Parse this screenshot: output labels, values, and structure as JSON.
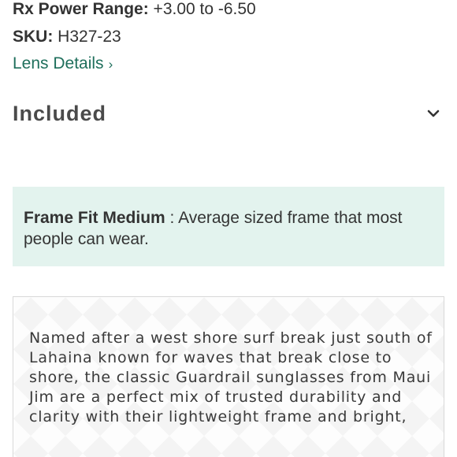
{
  "specs": {
    "rx_label": "Rx Power Range:",
    "rx_value": " +3.00 to -6.50",
    "sku_label": "SKU:",
    "sku_value": " H327-23"
  },
  "lens_link": {
    "label": "Lens Details",
    "icon": "chevron-right-icon"
  },
  "included": {
    "title": "Included",
    "icon": "chevron-down-icon"
  },
  "frame_fit": {
    "title": "Frame Fit Medium",
    "separator": " : ",
    "text": "Average sized frame that most people can wear."
  },
  "description": {
    "text": "Named after a west shore surf break just south of Lahaina known for waves that break close to shore, the classic Guardrail sunglasses from Maui Jim are a perfect mix of trusted durability and clarity with their lightweight frame and bright,"
  },
  "colors": {
    "link": "#1f6f5c",
    "fit_box_background": "#e3f3ee",
    "heading": "#4a4a4a"
  }
}
